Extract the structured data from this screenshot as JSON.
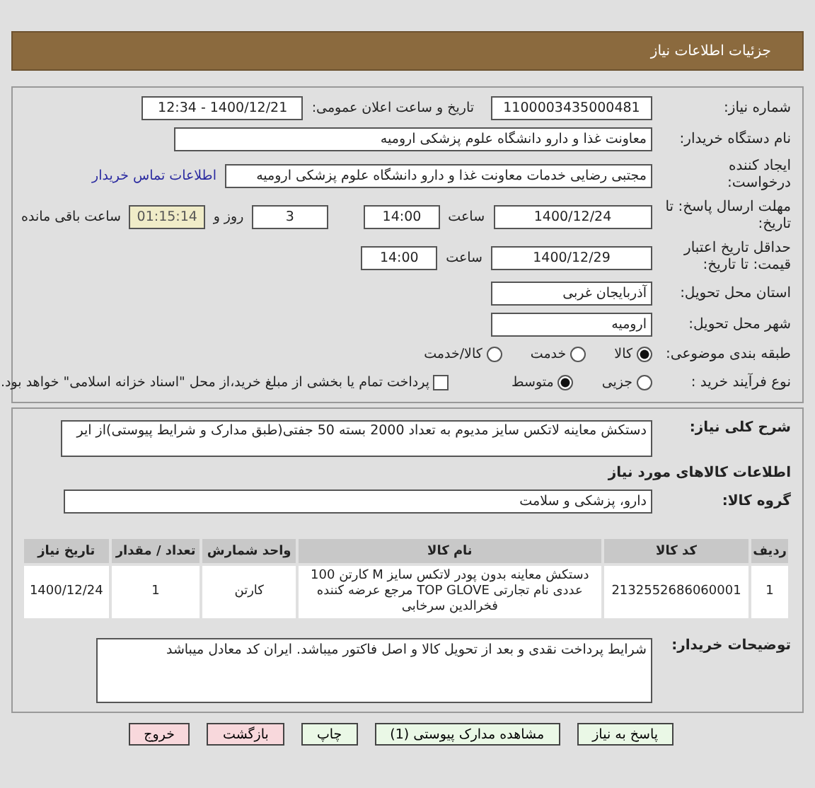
{
  "header": {
    "title": "جزئیات اطلاعات نیاز"
  },
  "need_number": {
    "label": "شماره نیاز:",
    "value": "1100003435000481"
  },
  "announce": {
    "label": "تاریخ و ساعت اعلان عمومی:",
    "value": "1400/12/21 - 12:34"
  },
  "buyer": {
    "label": "نام دستگاه خریدار:",
    "value": "معاونت غذا و دارو دانشگاه علوم پزشکی ارومیه"
  },
  "creator": {
    "label": "ایجاد کننده درخواست:",
    "value": "مجتبی رضایی خدمات معاونت غذا و دارو دانشگاه علوم پزشکی ارومیه",
    "link": "اطلاعات تماس خریدار"
  },
  "deadline": {
    "label": "مهلت ارسال پاسخ: تا تاریخ:",
    "date": "1400/12/24",
    "time_label": "ساعت",
    "time": "14:00",
    "days": "3",
    "days_label": "روز و",
    "remaining": "01:15:14",
    "remaining_label": "ساعت باقی مانده"
  },
  "validity": {
    "label": "حداقل تاریخ اعتبار قیمت: تا تاریخ:",
    "date": "1400/12/29",
    "time_label": "ساعت",
    "time": "14:00"
  },
  "province": {
    "label": "استان محل تحویل:",
    "value": "آذربایجان غربی"
  },
  "city": {
    "label": "شهر محل تحویل:",
    "value": "ارومیه"
  },
  "category": {
    "label": "طبقه بندی موضوعی:",
    "options": [
      {
        "label": "کالا",
        "selected": true
      },
      {
        "label": "خدمت",
        "selected": false
      },
      {
        "label": "کالا/خدمت",
        "selected": false
      }
    ]
  },
  "process": {
    "label": "نوع فرآیند خرید :",
    "options": [
      {
        "label": "جزیی",
        "selected": false
      },
      {
        "label": "متوسط",
        "selected": true
      }
    ],
    "treasury": {
      "label": "پرداخت تمام یا بخشی از مبلغ خرید،از محل \"اسناد خزانه اسلامی\" خواهد بود.",
      "checked": false
    }
  },
  "description": {
    "label": "شرح کلی نیاز:",
    "value": "دستکش معاینه لاتکس سایز مدیوم به تعداد 2000 بسته 50 جفتی(طبق مدارک و شرایط پیوستی)از ایر"
  },
  "goods_heading": "اطلاعات کالاهای مورد نیاز",
  "goods_group": {
    "label": "گروه کالا:",
    "value": "دارو، پزشکی و سلامت"
  },
  "table": {
    "columns": [
      "ردیف",
      "کد کالا",
      "نام کالا",
      "واحد شمارش",
      "تعداد / مقدار",
      "تاریخ نیاز"
    ],
    "rows": [
      [
        "1",
        "2132552686060001",
        "دستکش معاینه بدون پودر لاتکس سایز M کارتن 100 عددی نام تجارتی TOP GLOVE مرجع عرضه کننده فخرالدین سرخابی",
        "کارتن",
        "1",
        "1400/12/24"
      ]
    ]
  },
  "buyer_notes": {
    "label": "توضیحات خریدار:",
    "value": "شرایط پرداخت نقدی و بعد از تحویل کالا و اصل فاکتور میباشد. ایران کد معادل میباشد"
  },
  "buttons": [
    {
      "label": "پاسخ به نیاز",
      "kind": "primary"
    },
    {
      "label": "مشاهده مدارک پیوستی (1)",
      "kind": "primary"
    },
    {
      "label": "چاپ",
      "kind": "primary"
    },
    {
      "label": "بازگشت",
      "kind": "danger"
    },
    {
      "label": "خروج",
      "kind": "danger"
    }
  ]
}
